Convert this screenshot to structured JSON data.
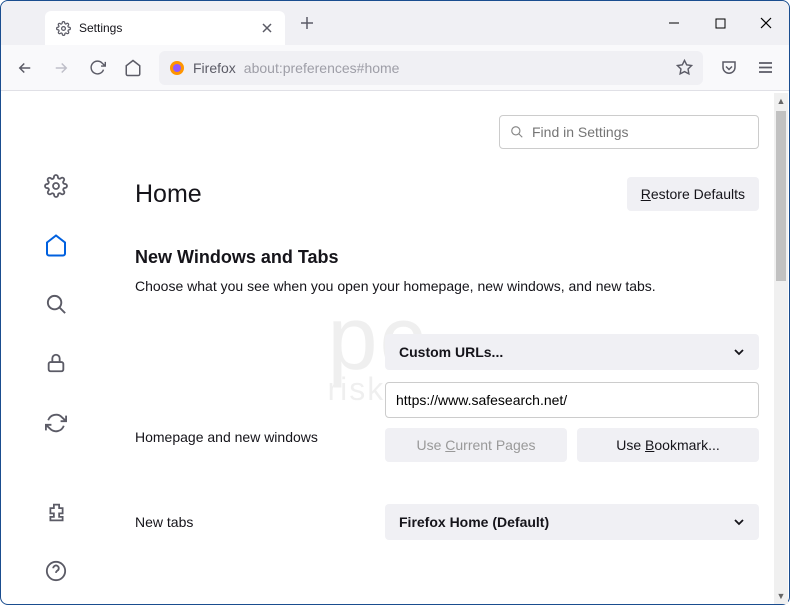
{
  "titlebar": {
    "tab_title": "Settings"
  },
  "toolbar": {
    "url_prefix": "Firefox",
    "url": "about:preferences#home"
  },
  "search": {
    "placeholder": "Find in Settings"
  },
  "page": {
    "title": "Home",
    "restore_defaults": "estore Defaults",
    "restore_defaults_accel": "R"
  },
  "section": {
    "title": "New Windows and Tabs",
    "desc": "Choose what you see when you open your homepage, new windows, and new tabs."
  },
  "homepage": {
    "label": "Homepage and new windows",
    "select_value": "Custom URLs...",
    "url_value": "https://www.safesearch.net/",
    "use_current_pre": "Use ",
    "use_current_accel": "C",
    "use_current_post": "urrent Pages",
    "use_bookmark_pre": "Use ",
    "use_bookmark_accel": "B",
    "use_bookmark_post": "ookmark..."
  },
  "newtabs": {
    "label": "New tabs",
    "select_value": "Firefox Home (Default)"
  },
  "watermark": {
    "main": "pc",
    "sub": "risk.com"
  }
}
